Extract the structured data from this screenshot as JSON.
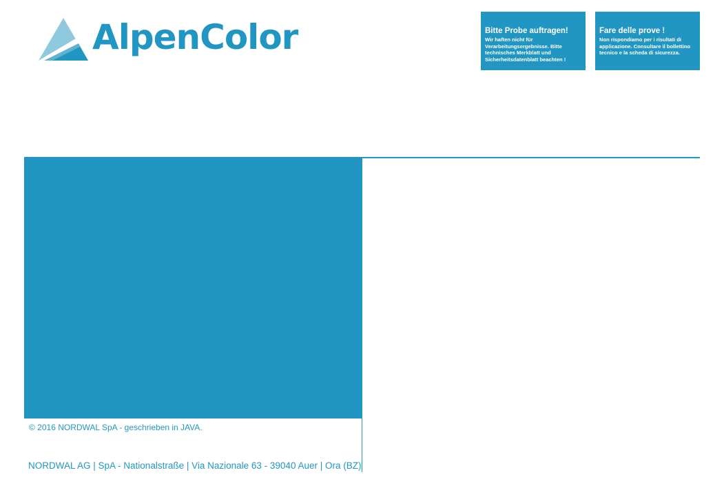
{
  "brand": {
    "name": "AlpenColor",
    "color": "#2196c3",
    "logo_icon": "mountain-triangle-icon"
  },
  "notices": {
    "de": {
      "title": "Bitte Probe auftragen!",
      "body": "Wir haften nicht für Verarbeitungsergebnisse. Bitte technisches Merkblatt und Sicherheitsdatenblatt beachten !"
    },
    "it": {
      "title": "Fare delle prove !",
      "body": "Non rispondiamo per i risultati di applicazione. Consultare il bollettino tecnico e la scheda di sicurezza."
    }
  },
  "footer": {
    "copyright": "© 2016 NORDWAL SpA - geschrieben in JAVA.",
    "address": "NORDWAL AG | SpA - Nationalstraße | Via Nazionale 63 - 39040 Auer | Ora (BZ)"
  },
  "colors": {
    "accent": "#2196c3",
    "logo_light": "#8fc9dd",
    "logo_mid": "#5fb3d1"
  }
}
